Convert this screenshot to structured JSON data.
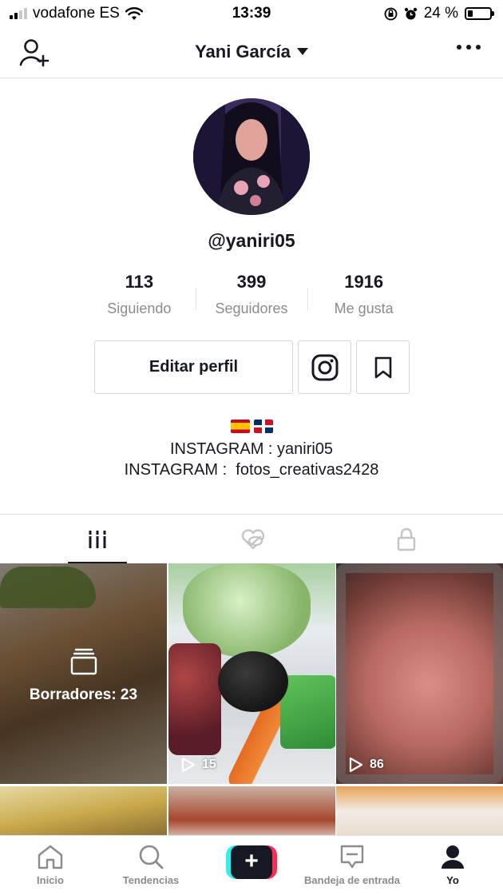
{
  "status_bar": {
    "carrier": "vodafone ES",
    "time": "13:39",
    "battery": "24 %",
    "battery_level": 0.24
  },
  "header": {
    "title": "Yani García",
    "icons": [
      "add-user-icon",
      "caret-down-icon",
      "more-icon"
    ]
  },
  "profile": {
    "username": "@yaniri05",
    "stats": [
      {
        "value": "113",
        "label": "Siguiendo"
      },
      {
        "value": "399",
        "label": "Seguidores"
      },
      {
        "value": "1916",
        "label": "Me gusta"
      }
    ],
    "edit_button": "Editar perfil",
    "bio": {
      "flags": [
        "spain-flag",
        "dominican-republic-flag"
      ],
      "line1": "INSTAGRAM : yaniri05",
      "line2": "INSTAGRAM :  fotos_creativas2428"
    }
  },
  "tabs": [
    {
      "icon": "videos-grid-icon",
      "active": true
    },
    {
      "icon": "liked-hidden-icon",
      "active": false
    },
    {
      "icon": "lock-icon",
      "active": false
    }
  ],
  "grid": {
    "drafts_label": "Borradores: 23",
    "videos": [
      {
        "plays": "15"
      },
      {
        "plays": "86"
      }
    ]
  },
  "bottom_nav": [
    {
      "label": "Inicio",
      "icon": "home-icon"
    },
    {
      "label": "Tendencias",
      "icon": "search-icon"
    },
    {
      "label": "",
      "icon": "plus-icon"
    },
    {
      "label": "Bandeja de entrada",
      "icon": "inbox-icon"
    },
    {
      "label": "Yo",
      "icon": "profile-icon"
    }
  ],
  "colors": {
    "text": "#161823",
    "secondary": "#8a8b91",
    "divider": "#e3e3e4",
    "accent_cyan": "#25f4ee",
    "accent_red": "#fe2c55"
  }
}
